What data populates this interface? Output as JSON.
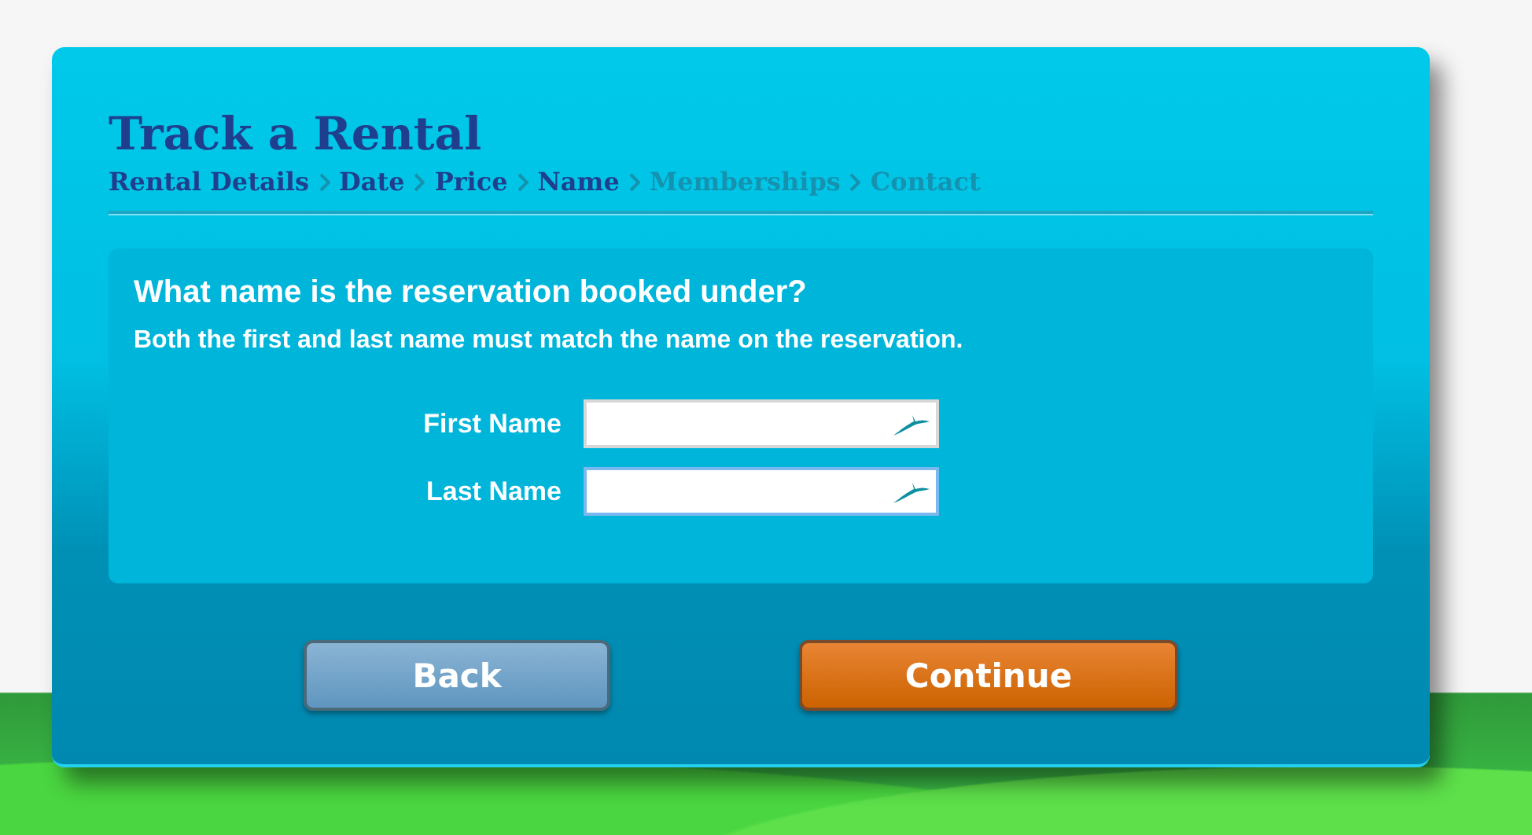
{
  "title": "Track a Rental",
  "steps": [
    {
      "label": "Rental Details",
      "reached": true
    },
    {
      "label": "Date",
      "reached": true
    },
    {
      "label": "Price",
      "reached": true
    },
    {
      "label": "Name",
      "reached": true
    },
    {
      "label": "Memberships",
      "reached": false
    },
    {
      "label": "Contact",
      "reached": false
    }
  ],
  "question": "What name is the reservation booked under?",
  "hint": "Both the first and last name must match the name on the reservation.",
  "fields": [
    {
      "label": "First Name",
      "focused": false
    },
    {
      "label": "Last Name",
      "focused": true
    }
  ],
  "buttons": [
    {
      "label": "Back",
      "kind": "secondary"
    },
    {
      "label": "Continue",
      "kind": "primary"
    }
  ]
}
